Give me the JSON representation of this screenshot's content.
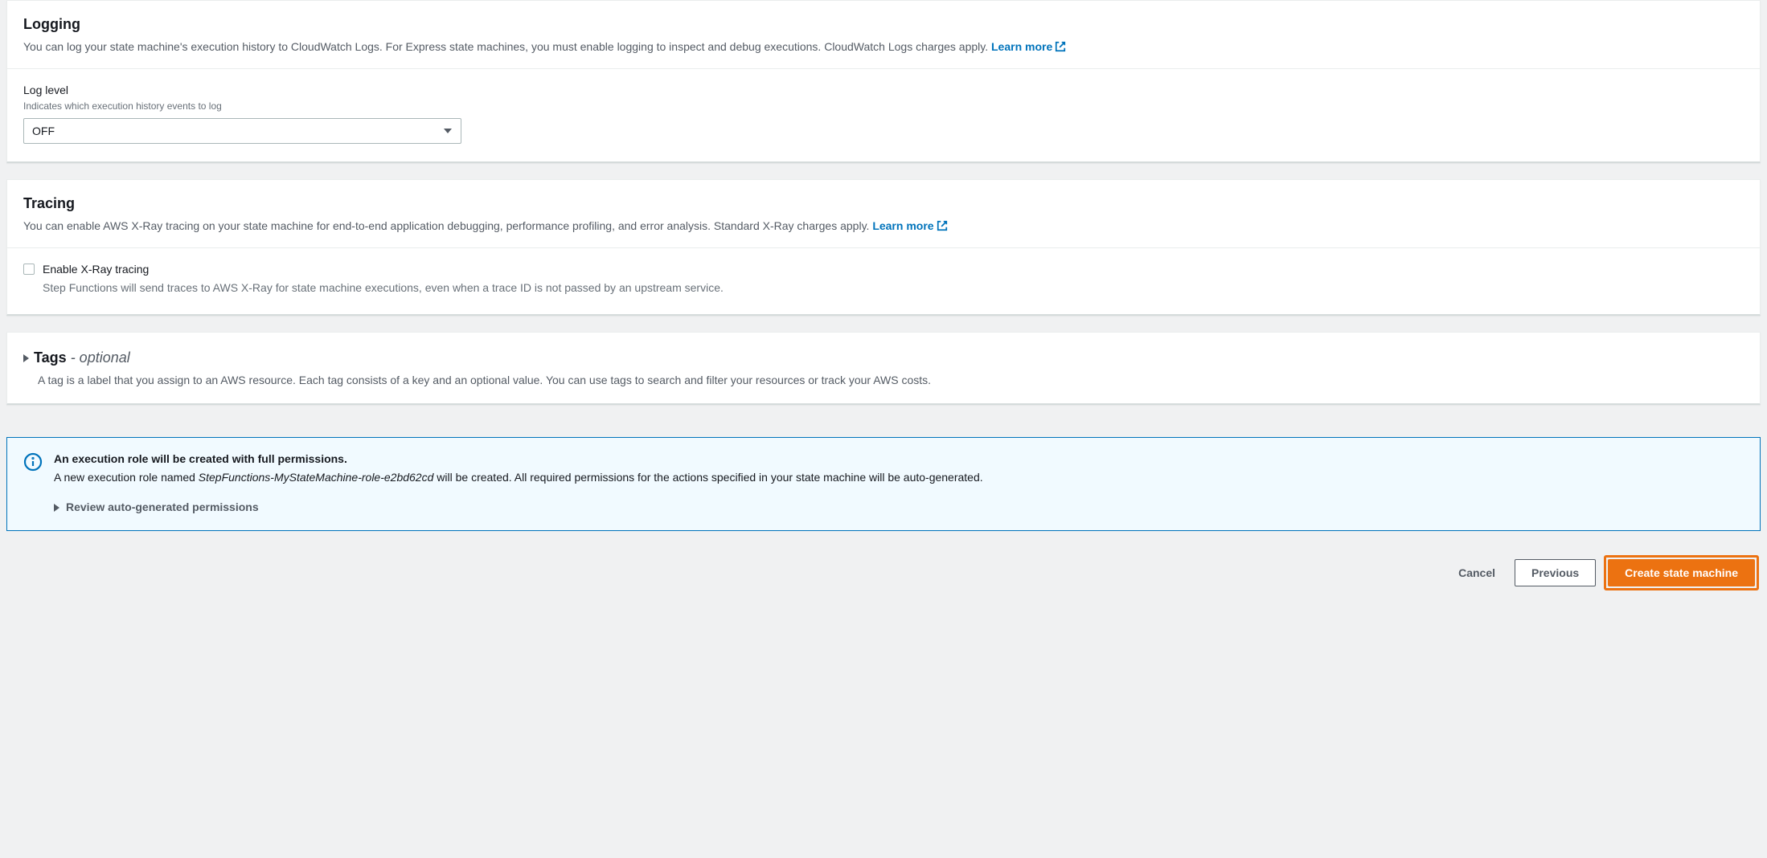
{
  "logging": {
    "title": "Logging",
    "description": "You can log your state machine's execution history to CloudWatch Logs. For Express state machines, you must enable logging to inspect and debug executions. CloudWatch Logs charges apply.  ",
    "learn_more": "Learn more",
    "log_level_label": "Log level",
    "log_level_hint": "Indicates which execution history events to log",
    "log_level_value": "OFF"
  },
  "tracing": {
    "title": "Tracing",
    "description": "You can enable AWS X-Ray tracing on your state machine for end-to-end application debugging, performance profiling, and error analysis. Standard X-Ray charges apply. ",
    "learn_more": "Learn more",
    "checkbox_label": "Enable X-Ray tracing",
    "checkbox_sub": "Step Functions will send traces to AWS X-Ray for state machine executions, even when a trace ID is not passed by an upstream service."
  },
  "tags": {
    "title": "Tags",
    "optional_suffix": " - optional",
    "description": "A tag is a label that you assign to an AWS resource. Each tag consists of a key and an optional value. You can use tags to search and filter your resources or track your AWS costs."
  },
  "alert": {
    "title": "An execution role will be created with full permissions.",
    "text_prefix": "A new execution role named ",
    "role_name": "StepFunctions-MyStateMachine-role-e2bd62cd",
    "text_suffix": " will be created. All required permissions for the actions specified in your state machine will be auto-generated.",
    "review_label": "Review auto-generated permissions"
  },
  "footer": {
    "cancel": "Cancel",
    "previous": "Previous",
    "create": "Create state machine"
  }
}
